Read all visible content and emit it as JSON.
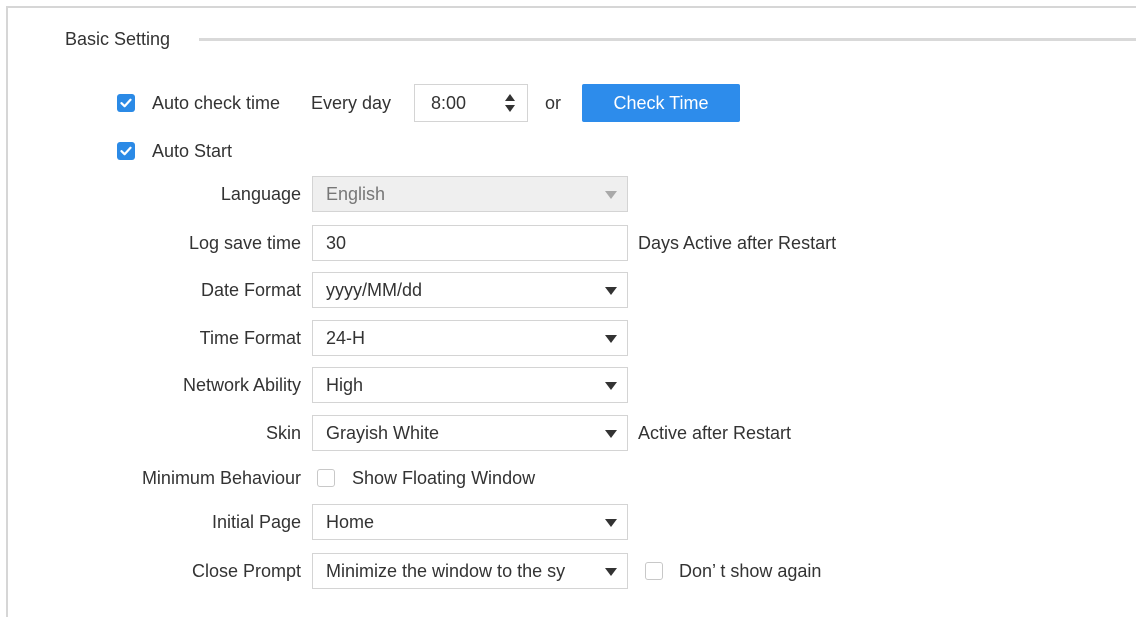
{
  "section": {
    "title": "Basic Setting"
  },
  "auto_check": {
    "checked": true,
    "label": "Auto check time",
    "frequency": "Every day",
    "time_value": "8:00",
    "or_text": "or",
    "button_label": "Check Time"
  },
  "auto_start": {
    "checked": true,
    "label": "Auto Start"
  },
  "language": {
    "label": "Language",
    "value": "English",
    "disabled": true
  },
  "log_save": {
    "label": "Log save time",
    "value": "30",
    "suffix": "Days  Active after Restart"
  },
  "date_format": {
    "label": "Date Format",
    "value": "yyyy/MM/dd"
  },
  "time_format": {
    "label": "Time Format",
    "value": "24-H"
  },
  "network": {
    "label": "Network Ability",
    "value": "High"
  },
  "skin": {
    "label": "Skin",
    "value": "Grayish White",
    "note": "Active after Restart"
  },
  "minimum": {
    "label": "Minimum Behaviour",
    "checkbox_checked": false,
    "checkbox_label": "Show Floating Window"
  },
  "initial_page": {
    "label": "Initial Page",
    "value": "Home"
  },
  "close_prompt": {
    "label": "Close Prompt",
    "value": "Minimize the window to the sy",
    "dont_show_checked": false,
    "dont_show_label": "Don’ t show again"
  },
  "colors": {
    "accent": "#2d8ceb",
    "checkbox": "#2b8ae6",
    "border": "#d4d4d4",
    "disabled_bg": "#efefef"
  }
}
